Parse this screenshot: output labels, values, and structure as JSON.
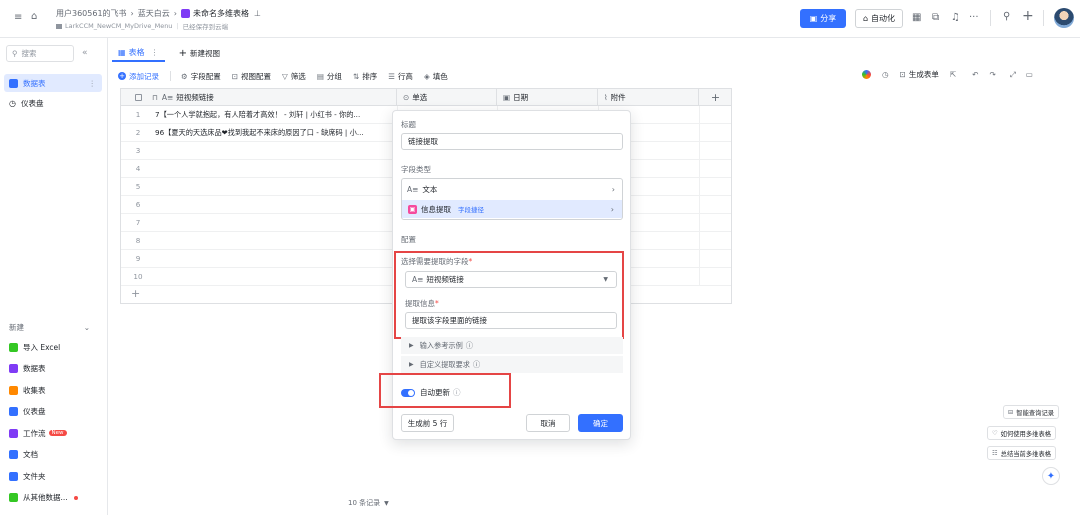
{
  "header": {
    "breadcrumb_user": "用户360561的飞书",
    "breadcrumb_folder": "蓝天白云",
    "doc_title": "未命名多维表格",
    "path": "LarkCCM_NewCM_MyDrive_Menu",
    "saved": "已经保存到云端",
    "share_label": "分享",
    "auto_label": "自动化",
    "more": "···",
    "plus": "+"
  },
  "sidebar": {
    "search_placeholder": "搜索",
    "collapse": "«",
    "items": [
      {
        "label": "数据表",
        "icon": "table-icon"
      },
      {
        "label": "仪表盘",
        "icon": "dashboard-icon"
      }
    ],
    "new_label": "新建",
    "new_items": [
      {
        "label": "导入 Excel",
        "icon": "excel-icon",
        "color": "#34c724"
      },
      {
        "label": "数据表",
        "icon": "table-icon",
        "color": "#7f3bf5"
      },
      {
        "label": "收集表",
        "icon": "form-icon",
        "color": "#ff8800"
      },
      {
        "label": "仪表盘",
        "icon": "dashboard-icon",
        "color": "#3370ff"
      },
      {
        "label": "工作流",
        "icon": "workflow-icon",
        "color": "#7f3bf5",
        "badge": "New"
      },
      {
        "label": "文档",
        "icon": "doc-icon",
        "color": "#3370ff"
      },
      {
        "label": "文件夹",
        "icon": "folder-icon",
        "color": "#3370ff"
      },
      {
        "label": "从其他数据...",
        "icon": "import-icon",
        "color": "#34c724"
      }
    ]
  },
  "tabs": {
    "table": "表格",
    "new_view": "新建视图"
  },
  "toolbar": {
    "add_record": "添加记录",
    "field_config": "字段配置",
    "view_config": "视图配置",
    "filter": "筛选",
    "group": "分组",
    "sort": "排序",
    "row_height": "行高",
    "fill_color": "填色",
    "gen_form": "生成表单"
  },
  "grid": {
    "columns": [
      "短视频链接",
      "单选",
      "日期",
      "附件"
    ],
    "rows": [
      {
        "num": "1",
        "value": "7【一个人学就抱起，有人陪着才高效！ - 刘轩 | 小红书 - 你的..."
      },
      {
        "num": "2",
        "value": "96【夏天的天选床品❤找到我起不来床的原因了口 - 缺席码 | 小..."
      },
      {
        "num": "3",
        "value": ""
      },
      {
        "num": "4",
        "value": ""
      },
      {
        "num": "5",
        "value": ""
      },
      {
        "num": "6",
        "value": ""
      },
      {
        "num": "7",
        "value": ""
      },
      {
        "num": "8",
        "value": ""
      },
      {
        "num": "9",
        "value": ""
      },
      {
        "num": "10",
        "value": ""
      }
    ],
    "record_count": "10 条记录"
  },
  "panel": {
    "title_label": "标题",
    "title_value": "链接提取",
    "type_label": "字段类型",
    "type_text": "文本",
    "type_extract": "信息提取",
    "type_tag": "字段捷径",
    "config_label": "配置",
    "select_field_label": "选择需要提取的字段",
    "select_field_value": "短视频链接",
    "extract_label": "提取信息",
    "extract_value": "提取该字段里面的链接",
    "example": "输入参考示例",
    "custom_req": "自定义提取要求",
    "auto_update": "自动更新",
    "gen_first": "生成前 5 行",
    "cancel": "取消",
    "confirm": "确定"
  },
  "floating": {
    "smart_query": "智能查询记录",
    "how_to": "如何使用多维表格",
    "summarize": "总结当前多维表格"
  },
  "colors": {
    "accent": "#3370ff",
    "highlight": "#e54545"
  }
}
